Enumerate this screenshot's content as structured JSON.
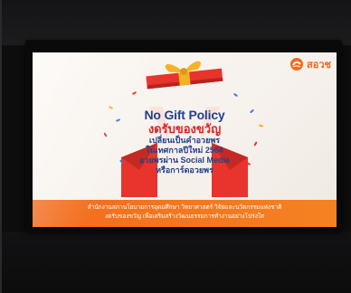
{
  "brand": {
    "name": "สอวช",
    "color": "#f06a18"
  },
  "announcement": {
    "title": "No Gift Policy",
    "subtitle": "งดรับของขวัญ",
    "lines": [
      "เปลี่ยนเป็นคำอวยพร",
      "ในเทศกาลปีใหม่ 2564",
      "อวยพรผ่าน Social Media",
      "หรือการ์ดอวยพร"
    ]
  },
  "footer": {
    "lines": [
      "สำนักงานสภานโยบายการอุดมศึกษา วิทยาศาสตร์ วิจัยและนวัตกรรมแห่งชาติ",
      "งดรับของขวัญ เพื่อเสริมสร้างวัฒนธรรมการทำงานอย่างโปร่งใส"
    ],
    "color": "#f26b1d"
  },
  "colors": {
    "title": "#24418c",
    "subtitle": "#e02126",
    "gift_box": "#e8342c",
    "ribbon": "#f5b324"
  },
  "icons": [
    "logo-mark-icon",
    "gift-box-icon",
    "confetti-icon"
  ]
}
